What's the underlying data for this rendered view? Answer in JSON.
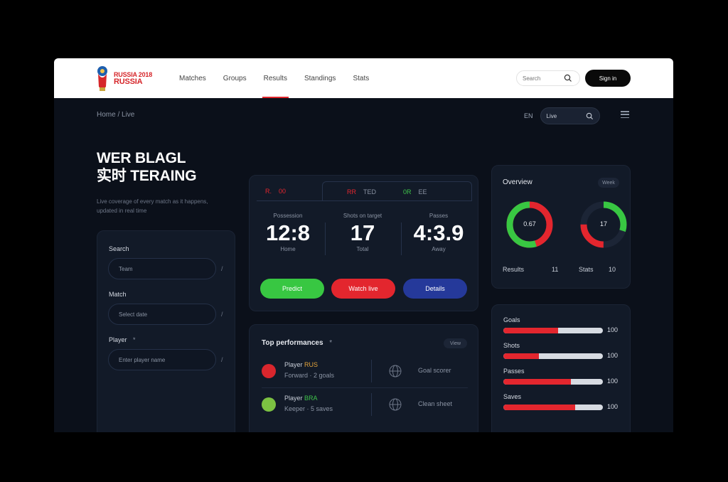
{
  "brand": {
    "line1": "RUSSIA 2018",
    "line2": "RUSSIA"
  },
  "nav": {
    "links": [
      "Matches",
      "Groups",
      "Results",
      "Standings",
      "Stats"
    ],
    "active_index": 2,
    "search_placeholder": "Search",
    "cta_label": "Sign in"
  },
  "subheader": {
    "breadcrumb": "Home / Live",
    "lang": "EN",
    "pill_label": "Live"
  },
  "hero": {
    "title_line1": "WER BLAGL",
    "title_line2": "实时 TERAING",
    "description": "Live coverage of every match as it happens, updated in real time"
  },
  "form": {
    "fields": [
      {
        "label": "Search",
        "value": "Team",
        "side": "/"
      },
      {
        "label": "Match",
        "value": "Select date",
        "side": "/"
      },
      {
        "label": "Player",
        "value": "Enter player name",
        "side": "/"
      }
    ],
    "label3_suffix": "*"
  },
  "scoreboard": {
    "tab1": {
      "a": "R.",
      "b": "00"
    },
    "tab2": {
      "a": "RR",
      "b": "TED",
      "c": "0R",
      "d": "EE"
    },
    "stats": [
      {
        "label": "Possession",
        "value": "12:8",
        "sub": "Home"
      },
      {
        "label": "Shots on target",
        "value": "17",
        "sub": "Total"
      },
      {
        "label": "Passes",
        "value": "4:3.9",
        "sub": "Away"
      }
    ],
    "buttons": [
      {
        "label": "Predict",
        "color": "#38c742"
      },
      {
        "label": "Watch live",
        "color": "#e3262e"
      },
      {
        "label": "Details",
        "color": "#25399a"
      }
    ]
  },
  "feed": {
    "title": "Top performances",
    "title_suffix": "*",
    "chip": "View",
    "rows": [
      {
        "name": "Player",
        "tag": "RUS",
        "detail": "Forward · 2 goals",
        "right": "Goal scorer",
        "avatar_color": "#d9262d"
      },
      {
        "name": "Player",
        "tag": "BRA",
        "detail": "Keeper · 5 saves",
        "right": "Clean sheet",
        "avatar_color": "#7cc142"
      }
    ]
  },
  "donuts": {
    "title": "Overview",
    "chip": "Week",
    "items": [
      {
        "value": "0.67",
        "green_pct": 0.55,
        "foot_label": "Results",
        "foot_value": "11"
      },
      {
        "value": "17",
        "green_pct": 0.3,
        "red_pct": 0.25,
        "foot_label": "Stats",
        "foot_value": "10"
      }
    ]
  },
  "progress": {
    "rows": [
      {
        "label": "Goals",
        "fill": 0.55,
        "max": "100"
      },
      {
        "label": "Shots",
        "fill": 0.36,
        "max": "100"
      },
      {
        "label": "Passes",
        "fill": 0.68,
        "max": "100"
      },
      {
        "label": "Saves",
        "fill": 0.72,
        "max": "100"
      }
    ],
    "colors": {
      "fill": "#e3262e",
      "track": "#d7dbe2"
    }
  }
}
